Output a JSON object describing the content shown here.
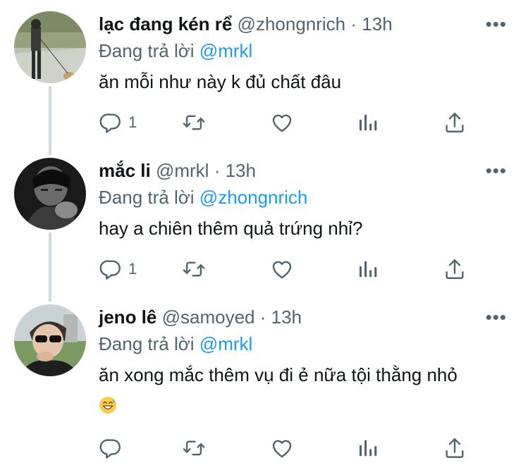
{
  "tweets": [
    {
      "name": "lạc đang kén rể",
      "handle": "@zhongnrich",
      "separator": "·",
      "time": "13h",
      "reply_prefix": "Đang trả lời",
      "reply_to": "@mrkl",
      "text": "ăn mỗi như này k đủ chất đâu",
      "reply_count": "1"
    },
    {
      "name": "mắc li",
      "handle": "@mrkl",
      "separator": "·",
      "time": "13h",
      "reply_prefix": "Đang trả lời",
      "reply_to": "@zhongnrich",
      "text": "hay a chiên thêm quả trứng nhỉ?",
      "reply_count": "1"
    },
    {
      "name": "jeno lê",
      "handle": "@samoyed",
      "separator": "·",
      "time": "13h",
      "reply_prefix": "Đang trả lời",
      "reply_to": "@mrkl",
      "text": "ăn xong mắc thêm vụ đi ẻ nữa tội thằng nhỏ",
      "emoji": "grinning-sweat-emoji",
      "reply_count": ""
    }
  ],
  "more_glyph": "•••",
  "colors": {
    "text": "#0f1419",
    "secondary": "#536471",
    "link": "#1d9bf0",
    "thread_line": "#cfd9de"
  }
}
